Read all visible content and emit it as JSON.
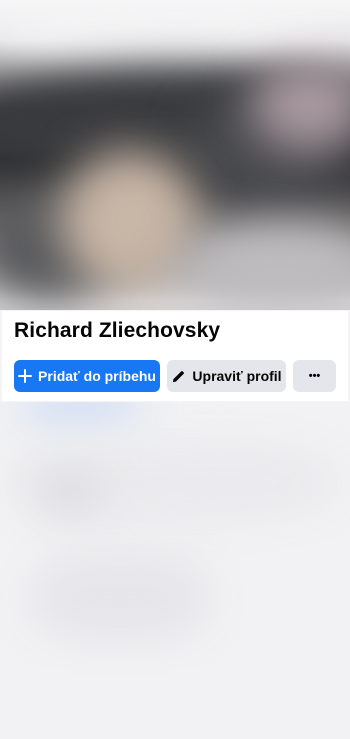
{
  "profile": {
    "name": "Richard Zliechovsky"
  },
  "actions": {
    "add_story_label": "Pridať do príbehu",
    "edit_profile_label": "Upraviť profil",
    "more_label": "•••"
  },
  "icons": {
    "add": "plus-icon",
    "edit": "pencil-icon",
    "more": "more-dots-icon"
  },
  "colors": {
    "primary": "#1877f2",
    "secondary": "#e4e6eb",
    "text": "#050505",
    "card": "#ffffff"
  }
}
